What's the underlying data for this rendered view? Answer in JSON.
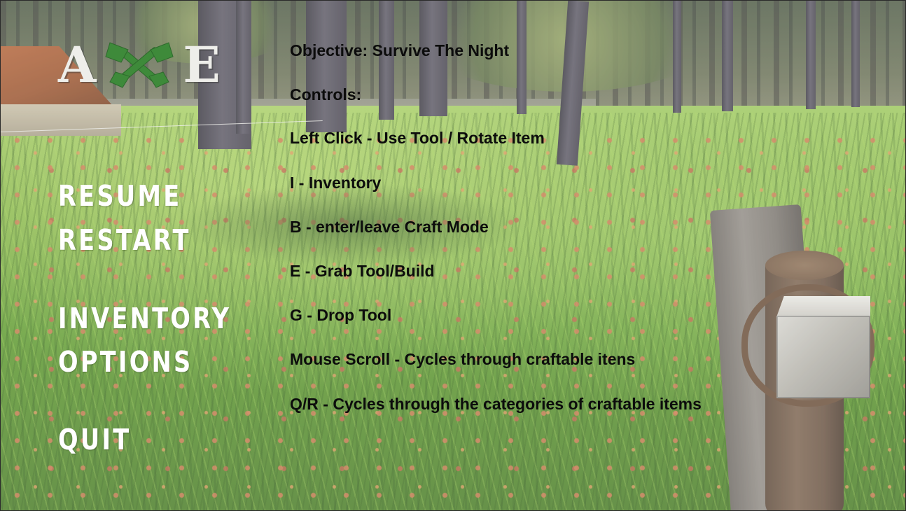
{
  "logo": {
    "letters": [
      "A",
      "E"
    ],
    "icon": "crossed-axes-icon",
    "icon_color": "#3e8a3a",
    "letter_color": "#eeeeea"
  },
  "menu": {
    "resume": "RESUME",
    "restart": "RESTART",
    "inventory": "INVENTORY",
    "options": "OPTIONS",
    "quit": "QUIT"
  },
  "info": {
    "objective": "Objective: Survive The Night",
    "controls_heading": "Controls:",
    "controls": [
      "Left Click - Use Tool / Rotate Item",
      "I - Inventory",
      "B - enter/leave Craft Mode",
      "E - Grab Tool/Build",
      "G - Drop Tool",
      "Mouse Scroll - Cycles through craftable itens",
      "Q/R - Cycles through the categories of craftable items"
    ]
  },
  "scene": {
    "held_item": "axe",
    "setting": "forest meadow"
  }
}
